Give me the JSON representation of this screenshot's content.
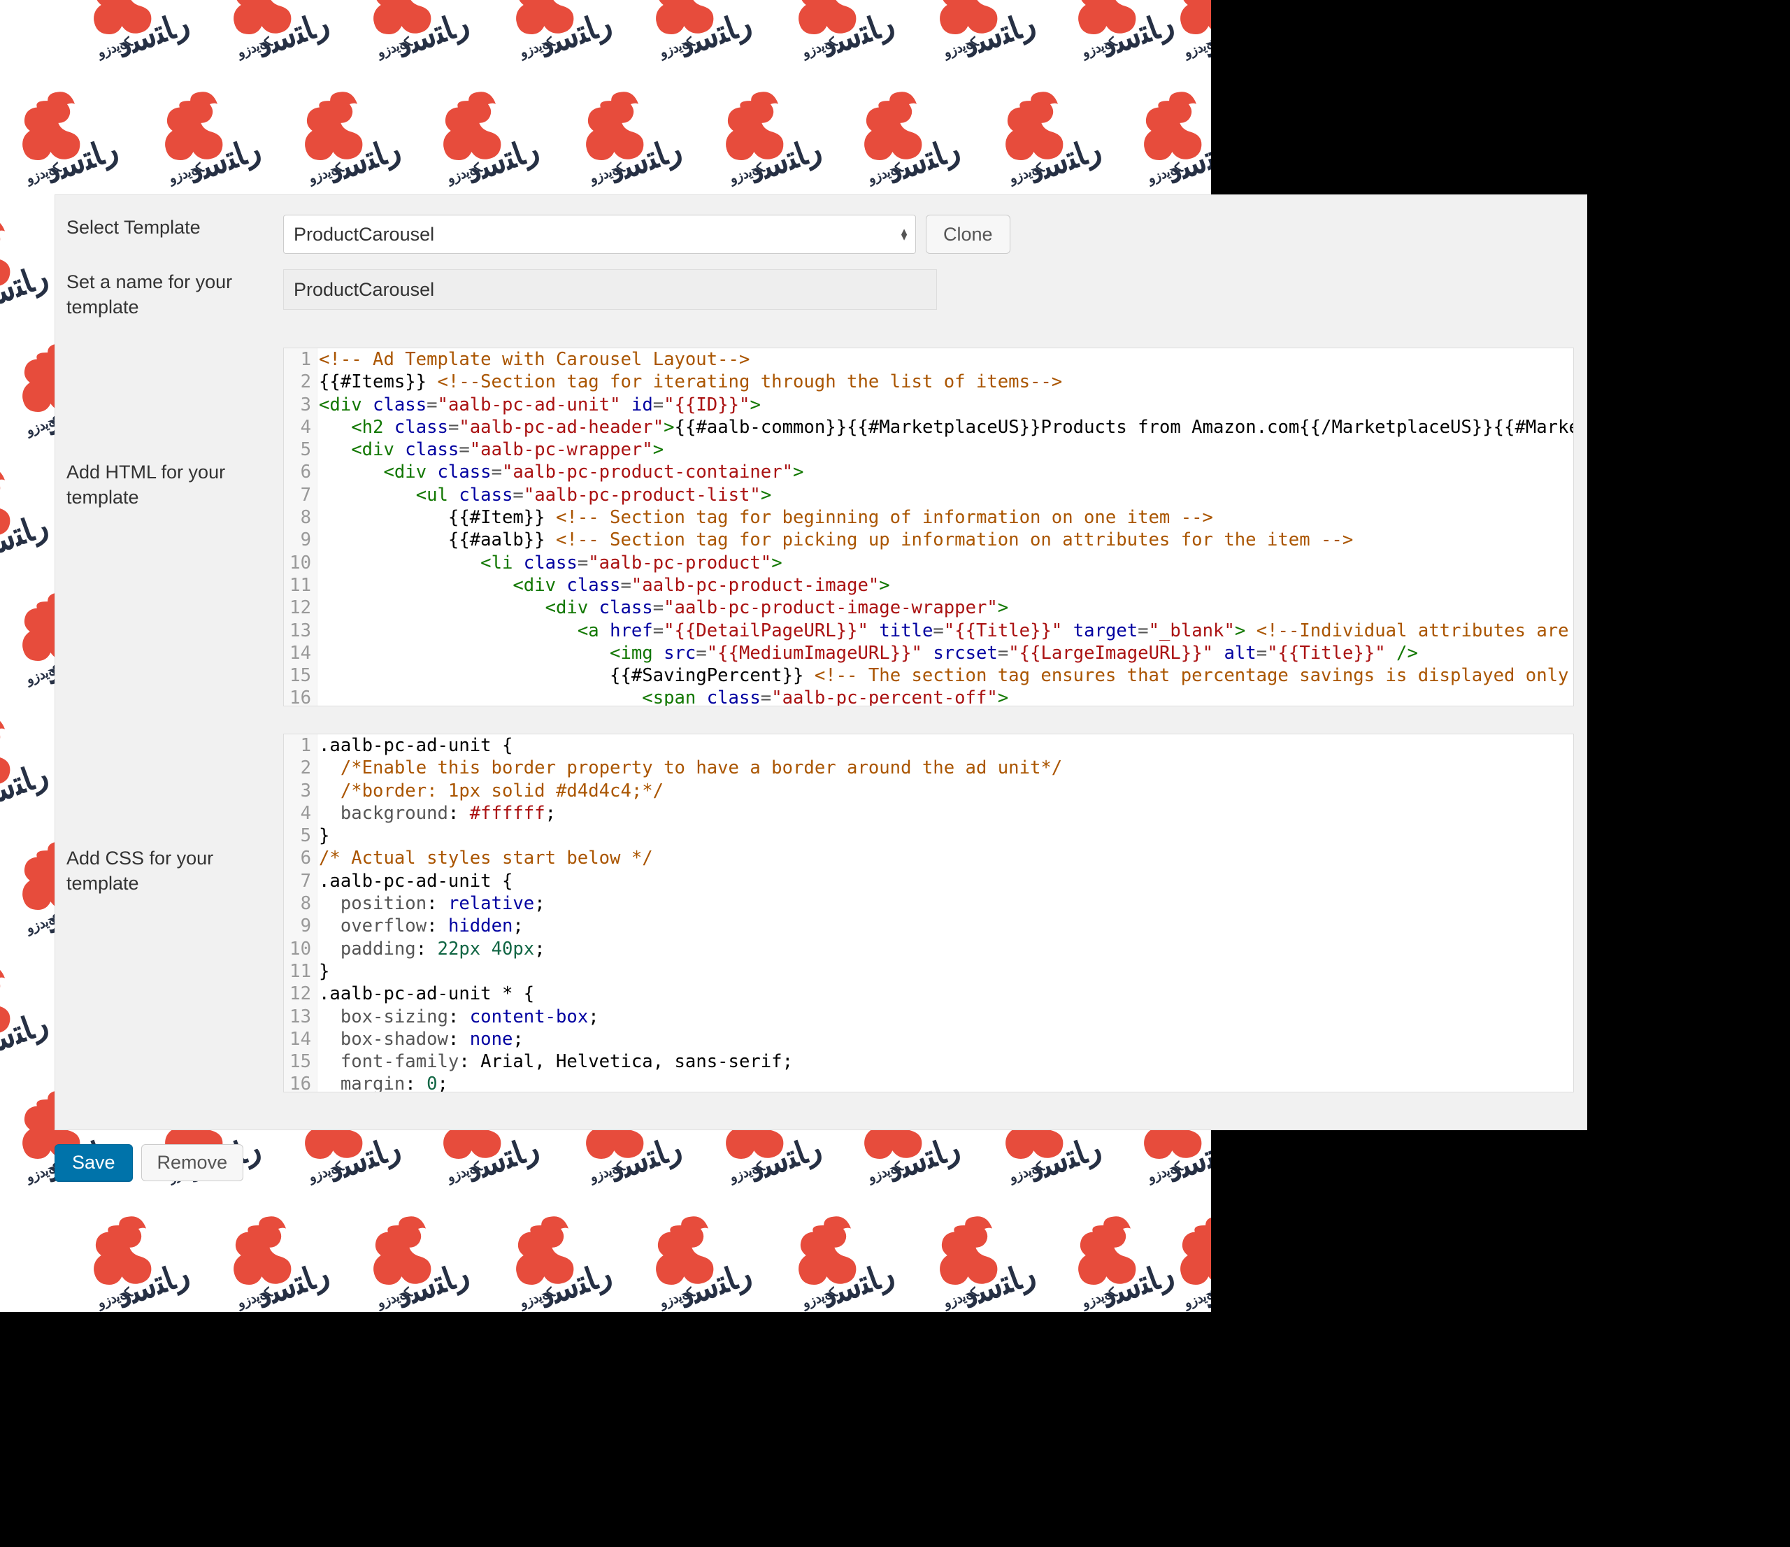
{
  "labels": {
    "select_template": "Select Template",
    "set_name": "Set a name for your template",
    "add_html": "Add HTML for your template",
    "add_css": "Add CSS for your template"
  },
  "controls": {
    "template_value": "ProductCarousel",
    "clone_label": "Clone",
    "name_value": "ProductCarousel",
    "save_label": "Save",
    "remove_label": "Remove"
  },
  "html_code": [
    {
      "n": "1",
      "tokens": [
        [
          "comm",
          "<!-- Ad Template with Carousel Layout-->"
        ]
      ]
    },
    {
      "n": "2",
      "tokens": [
        [
          "expr",
          "{{#Items}} "
        ],
        [
          "comm",
          "<!--Section tag for iterating through the list of items-->"
        ]
      ]
    },
    {
      "n": "3",
      "tokens": [
        [
          "brkt",
          "<"
        ],
        [
          "tag",
          "div "
        ],
        [
          "attr",
          "class"
        ],
        [
          "eq",
          "="
        ],
        [
          "str",
          "\"aalb-pc-ad-unit\""
        ],
        [
          "tag",
          " "
        ],
        [
          "attr",
          "id"
        ],
        [
          "eq",
          "="
        ],
        [
          "str",
          "\"{{ID}}\""
        ],
        [
          "brkt",
          ">"
        ]
      ]
    },
    {
      "n": "4",
      "tokens": [
        [
          "plain",
          "   "
        ],
        [
          "brkt",
          "<"
        ],
        [
          "tag",
          "h2 "
        ],
        [
          "attr",
          "class"
        ],
        [
          "eq",
          "="
        ],
        [
          "str",
          "\"aalb-pc-ad-header\""
        ],
        [
          "brkt",
          ">"
        ],
        [
          "expr",
          "{{#aalb-common}}{{#MarketplaceUS}}Products from Amazon.com{{/MarketplaceUS}}{{#MarketplaceFR"
        ]
      ]
    },
    {
      "n": "5",
      "tokens": [
        [
          "plain",
          "   "
        ],
        [
          "brkt",
          "<"
        ],
        [
          "tag",
          "div "
        ],
        [
          "attr",
          "class"
        ],
        [
          "eq",
          "="
        ],
        [
          "str",
          "\"aalb-pc-wrapper\""
        ],
        [
          "brkt",
          ">"
        ]
      ]
    },
    {
      "n": "6",
      "tokens": [
        [
          "plain",
          "      "
        ],
        [
          "brkt",
          "<"
        ],
        [
          "tag",
          "div "
        ],
        [
          "attr",
          "class"
        ],
        [
          "eq",
          "="
        ],
        [
          "str",
          "\"aalb-pc-product-container\""
        ],
        [
          "brkt",
          ">"
        ]
      ]
    },
    {
      "n": "7",
      "tokens": [
        [
          "plain",
          "         "
        ],
        [
          "brkt",
          "<"
        ],
        [
          "tag",
          "ul "
        ],
        [
          "attr",
          "class"
        ],
        [
          "eq",
          "="
        ],
        [
          "str",
          "\"aalb-pc-product-list\""
        ],
        [
          "brkt",
          ">"
        ]
      ]
    },
    {
      "n": "8",
      "tokens": [
        [
          "plain",
          "            "
        ],
        [
          "expr",
          "{{#Item}} "
        ],
        [
          "comm",
          "<!-- Section tag for beginning of information on one item -->"
        ]
      ]
    },
    {
      "n": "9",
      "tokens": [
        [
          "plain",
          "            "
        ],
        [
          "expr",
          "{{#aalb}} "
        ],
        [
          "comm",
          "<!-- Section tag for picking up information on attributes for the item -->"
        ]
      ]
    },
    {
      "n": "10",
      "tokens": [
        [
          "plain",
          "               "
        ],
        [
          "brkt",
          "<"
        ],
        [
          "tag",
          "li "
        ],
        [
          "attr",
          "class"
        ],
        [
          "eq",
          "="
        ],
        [
          "str",
          "\"aalb-pc-product\""
        ],
        [
          "brkt",
          ">"
        ]
      ]
    },
    {
      "n": "11",
      "tokens": [
        [
          "plain",
          "                  "
        ],
        [
          "brkt",
          "<"
        ],
        [
          "tag",
          "div "
        ],
        [
          "attr",
          "class"
        ],
        [
          "eq",
          "="
        ],
        [
          "str",
          "\"aalb-pc-product-image\""
        ],
        [
          "brkt",
          ">"
        ]
      ]
    },
    {
      "n": "12",
      "tokens": [
        [
          "plain",
          "                     "
        ],
        [
          "brkt",
          "<"
        ],
        [
          "tag",
          "div "
        ],
        [
          "attr",
          "class"
        ],
        [
          "eq",
          "="
        ],
        [
          "str",
          "\"aalb-pc-product-image-wrapper\""
        ],
        [
          "brkt",
          ">"
        ]
      ]
    },
    {
      "n": "13",
      "tokens": [
        [
          "plain",
          "                        "
        ],
        [
          "brkt",
          "<"
        ],
        [
          "tag",
          "a "
        ],
        [
          "attr",
          "href"
        ],
        [
          "eq",
          "="
        ],
        [
          "str",
          "\"{{DetailPageURL}}\""
        ],
        [
          "tag",
          " "
        ],
        [
          "attr",
          "title"
        ],
        [
          "eq",
          "="
        ],
        [
          "str",
          "\"{{Title}}\""
        ],
        [
          "tag",
          " "
        ],
        [
          "attr",
          "target"
        ],
        [
          "eq",
          "="
        ],
        [
          "str",
          "\"_blank\""
        ],
        [
          "brkt",
          ">"
        ],
        [
          "plain",
          " "
        ],
        [
          "comm",
          "<!--Individual attributes are provided as"
        ]
      ]
    },
    {
      "n": "14",
      "tokens": [
        [
          "plain",
          "                           "
        ],
        [
          "brkt",
          "<"
        ],
        [
          "tag",
          "img "
        ],
        [
          "attr",
          "src"
        ],
        [
          "eq",
          "="
        ],
        [
          "str",
          "\"{{MediumImageURL}}\""
        ],
        [
          "tag",
          " "
        ],
        [
          "attr",
          "srcset"
        ],
        [
          "eq",
          "="
        ],
        [
          "str",
          "\"{{LargeImageURL}}\""
        ],
        [
          "tag",
          " "
        ],
        [
          "attr",
          "alt"
        ],
        [
          "eq",
          "="
        ],
        [
          "str",
          "\"{{Title}}\""
        ],
        [
          "tag",
          " "
        ],
        [
          "brkt",
          "/>"
        ]
      ]
    },
    {
      "n": "15",
      "tokens": [
        [
          "plain",
          "                           "
        ],
        [
          "expr",
          "{{#SavingPercent}} "
        ],
        [
          "comm",
          "<!-- The section tag ensures that percentage savings is displayed only if it is ava"
        ]
      ]
    },
    {
      "n": "16",
      "tokens": [
        [
          "plain",
          "                              "
        ],
        [
          "brkt",
          "<"
        ],
        [
          "tag",
          "span "
        ],
        [
          "attr",
          "class"
        ],
        [
          "eq",
          "="
        ],
        [
          "str",
          "\"aalb-pc-percent-off\""
        ],
        [
          "brkt",
          ">"
        ]
      ]
    }
  ],
  "css_code": [
    {
      "n": "1",
      "tokens": [
        [
          "sel",
          ".aalb-pc-ad-unit "
        ],
        [
          "plain",
          "{"
        ]
      ]
    },
    {
      "n": "2",
      "tokens": [
        [
          "plain",
          "  "
        ],
        [
          "comm",
          "/*Enable this border property to have a border around the ad unit*/"
        ]
      ]
    },
    {
      "n": "3",
      "tokens": [
        [
          "plain",
          "  "
        ],
        [
          "comm",
          "/*border: 1px solid #d4d4c4;*/"
        ]
      ]
    },
    {
      "n": "4",
      "tokens": [
        [
          "plain",
          "  "
        ],
        [
          "prop",
          "background"
        ],
        [
          "plain",
          ": "
        ],
        [
          "col",
          "#ffffff"
        ],
        [
          "plain",
          ";"
        ]
      ]
    },
    {
      "n": "5",
      "tokens": [
        [
          "plain",
          "}"
        ]
      ]
    },
    {
      "n": "6",
      "tokens": [
        [
          "comm",
          "/* Actual styles start below */"
        ]
      ]
    },
    {
      "n": "7",
      "tokens": [
        [
          "sel",
          ".aalb-pc-ad-unit "
        ],
        [
          "plain",
          "{"
        ]
      ]
    },
    {
      "n": "8",
      "tokens": [
        [
          "plain",
          "  "
        ],
        [
          "prop",
          "position"
        ],
        [
          "plain",
          ": "
        ],
        [
          "kw",
          "relative"
        ],
        [
          "plain",
          ";"
        ]
      ]
    },
    {
      "n": "9",
      "tokens": [
        [
          "plain",
          "  "
        ],
        [
          "prop",
          "overflow"
        ],
        [
          "plain",
          ": "
        ],
        [
          "kw",
          "hidden"
        ],
        [
          "plain",
          ";"
        ]
      ]
    },
    {
      "n": "10",
      "tokens": [
        [
          "plain",
          "  "
        ],
        [
          "prop",
          "padding"
        ],
        [
          "plain",
          ": "
        ],
        [
          "num",
          "22px 40px"
        ],
        [
          "plain",
          ";"
        ]
      ]
    },
    {
      "n": "11",
      "tokens": [
        [
          "plain",
          "}"
        ]
      ]
    },
    {
      "n": "12",
      "tokens": [
        [
          "sel",
          ".aalb-pc-ad-unit * "
        ],
        [
          "plain",
          "{"
        ]
      ]
    },
    {
      "n": "13",
      "tokens": [
        [
          "plain",
          "  "
        ],
        [
          "prop",
          "box-sizing"
        ],
        [
          "plain",
          ": "
        ],
        [
          "kw",
          "content-box"
        ],
        [
          "plain",
          ";"
        ]
      ]
    },
    {
      "n": "14",
      "tokens": [
        [
          "plain",
          "  "
        ],
        [
          "prop",
          "box-shadow"
        ],
        [
          "plain",
          ": "
        ],
        [
          "kw",
          "none"
        ],
        [
          "plain",
          ";"
        ]
      ]
    },
    {
      "n": "15",
      "tokens": [
        [
          "plain",
          "  "
        ],
        [
          "prop",
          "font-family"
        ],
        [
          "plain",
          ": Arial, Helvetica, sans-serif;"
        ]
      ]
    },
    {
      "n": "16",
      "tokens": [
        [
          "plain",
          "  "
        ],
        [
          "prop",
          "margin"
        ],
        [
          "plain",
          ": "
        ],
        [
          "num",
          "0"
        ],
        [
          "plain",
          ";"
        ]
      ]
    }
  ],
  "logo_positions": [
    [
      96,
      -52
    ],
    [
      296,
      -52
    ],
    [
      496,
      -52
    ],
    [
      700,
      -52
    ],
    [
      900,
      -52
    ],
    [
      1104,
      -52
    ],
    [
      1306,
      -52
    ],
    [
      1504,
      -52
    ],
    [
      1650,
      -52
    ],
    [
      -6,
      128
    ],
    [
      198,
      128
    ],
    [
      398,
      128
    ],
    [
      596,
      128
    ],
    [
      800,
      128
    ],
    [
      1000,
      128
    ],
    [
      1198,
      128
    ],
    [
      1400,
      128
    ],
    [
      1598,
      128
    ],
    [
      -106,
      310
    ],
    [
      96,
      310
    ],
    [
      -6,
      488
    ],
    [
      -106,
      666
    ],
    [
      96,
      666
    ],
    [
      -6,
      844
    ],
    [
      -106,
      1022
    ],
    [
      96,
      1022
    ],
    [
      -6,
      1200
    ],
    [
      -106,
      1378
    ],
    [
      96,
      1378
    ],
    [
      -6,
      1556
    ],
    [
      198,
      1556
    ],
    [
      398,
      1556
    ],
    [
      596,
      1556
    ],
    [
      800,
      1556
    ],
    [
      1000,
      1556
    ],
    [
      1198,
      1556
    ],
    [
      1400,
      1556
    ],
    [
      1598,
      1556
    ],
    [
      96,
      1736
    ],
    [
      296,
      1736
    ],
    [
      496,
      1736
    ],
    [
      700,
      1736
    ],
    [
      900,
      1736
    ],
    [
      1104,
      1736
    ],
    [
      1306,
      1736
    ],
    [
      1504,
      1736
    ],
    [
      1650,
      1736
    ]
  ]
}
